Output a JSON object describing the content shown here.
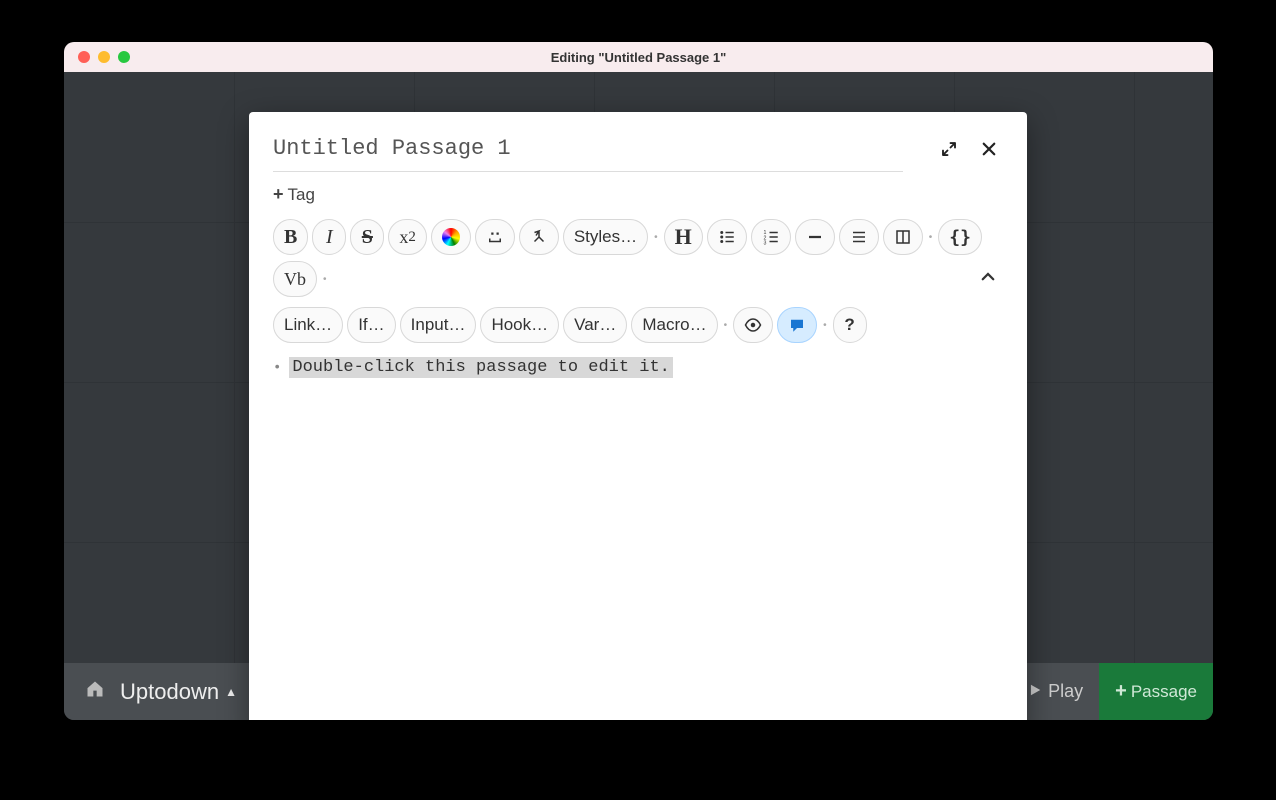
{
  "window": {
    "title": "Editing \"Untitled Passage 1\""
  },
  "bottom_bar": {
    "story_name": "Uptodown",
    "play_label": "Play",
    "add_passage_label": "Passage"
  },
  "editor": {
    "passage_title": "Untitled Passage 1",
    "tag_button_label": "Tag",
    "body_text": "Double-click this passage to edit it.",
    "toolbar_row1": {
      "styles_label": "Styles…",
      "vb_label": "Vb"
    },
    "toolbar_row2": {
      "link_label": "Link…",
      "if_label": "If…",
      "input_label": "Input…",
      "hook_label": "Hook…",
      "var_label": "Var…",
      "macro_label": "Macro…"
    }
  }
}
